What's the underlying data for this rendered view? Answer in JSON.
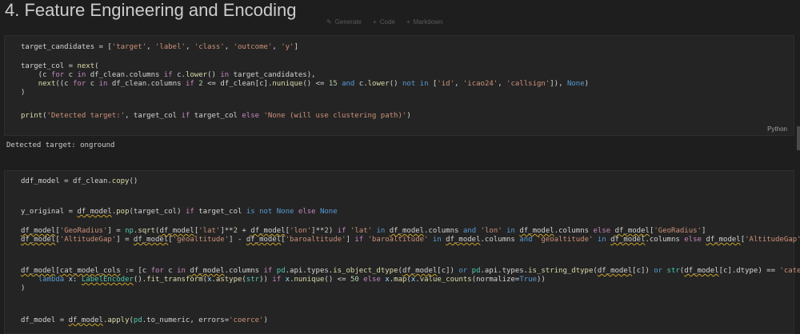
{
  "heading": "4. Feature Engineering and Encoding",
  "toolbar": {
    "generate": "Generate",
    "code": "Code",
    "markdown": "Markdown"
  },
  "cell1": {
    "lines": [
      "target_candidates = ['target', 'label', 'class', 'outcome', 'y']",
      "target_col = next(",
      "    (c for c in df_clean.columns if c.lower() in target_candidates),",
      "    next((c for c in df_clean.columns if 2 <= df_clean[c].nunique() <= 15 and c.lower() not in ['id', 'icao24', 'callsign']), None)",
      ")",
      "print('Detected target:', target_col if target_col else 'None (will use clustering path)')"
    ],
    "language": "Python"
  },
  "output": "Detected target: onground",
  "cell2": {
    "lines": [
      "ddf_model = df_clean.copy()",
      "y_original = df_model.pop(target_col) if target_col is not None else None",
      "df_model['GeoRadius'] = np.sqrt(df_model['lat']**2 + df_model['lon']**2) if 'lat' in df_model.columns and 'lon' in df_model.columns else df_model['GeoRadius']",
      "df_model['AltitudeGap'] = df_model['geoaltitude'] - df_model['baroaltitude'] if 'baroaltitude' in df_model.columns and 'geoaltitude' in df_model.columns else df_model['AltitudeGap']",
      "df_model[cat_model_cols := [c for c in df_model.columns if pd.api.types.is_object_dtype(df_model[c]) or pd.api.types.is_string_dtype(df_model[c]) or str(df_model[c].dtype) == 'category']] =",
      "    lambda x: LabelEncoder().fit_transform(x.astype(str)) if x.nunique() <= 50 else x.map(x.value_counts(normalize=True))",
      ")",
      "df_model = df_model.apply(pd.to_numeric, errors='coerce')"
    ]
  }
}
